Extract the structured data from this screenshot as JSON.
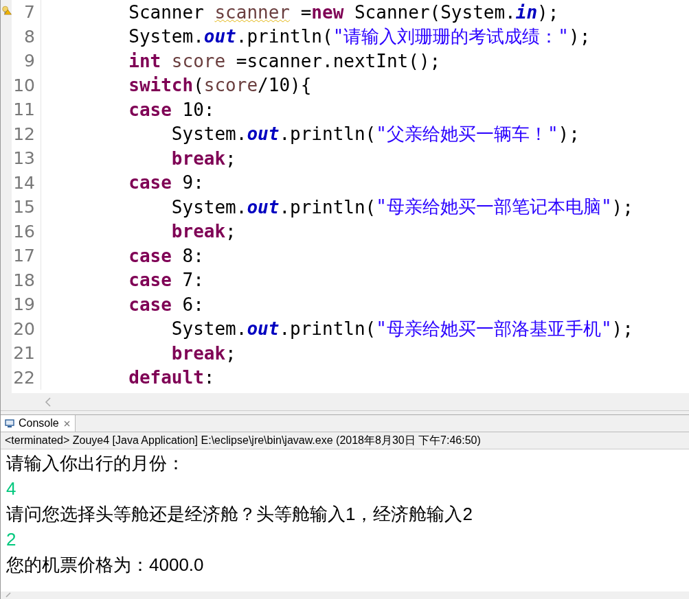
{
  "editor": {
    "lines": [
      {
        "number": "7",
        "marker": true,
        "tokens": [
          {
            "kind": "plain",
            "text": "        Scanner "
          },
          {
            "kind": "warn-var",
            "text": "scanner"
          },
          {
            "kind": "plain",
            "text": " ="
          },
          {
            "kind": "keyword",
            "text": "new"
          },
          {
            "kind": "plain",
            "text": " Scanner(System."
          },
          {
            "kind": "field",
            "text": "in"
          },
          {
            "kind": "plain",
            "text": ");"
          }
        ]
      },
      {
        "number": "8",
        "marker": false,
        "tokens": [
          {
            "kind": "plain",
            "text": "        System."
          },
          {
            "kind": "field",
            "text": "out"
          },
          {
            "kind": "plain",
            "text": ".println("
          },
          {
            "kind": "string",
            "text": "\"请输入刘珊珊的考试成绩：\""
          },
          {
            "kind": "plain",
            "text": ");"
          }
        ]
      },
      {
        "number": "9",
        "marker": false,
        "tokens": [
          {
            "kind": "keyword",
            "text": "        int "
          },
          {
            "kind": "var",
            "text": "score"
          },
          {
            "kind": "plain",
            "text": " =scanner.nextInt();"
          }
        ]
      },
      {
        "number": "10",
        "marker": false,
        "tokens": [
          {
            "kind": "keyword",
            "text": "        switch"
          },
          {
            "kind": "plain",
            "text": "("
          },
          {
            "kind": "var",
            "text": "score"
          },
          {
            "kind": "plain",
            "text": "/10){"
          }
        ]
      },
      {
        "number": "11",
        "marker": false,
        "tokens": [
          {
            "kind": "keyword",
            "text": "        case"
          },
          {
            "kind": "plain",
            "text": " 10:"
          }
        ]
      },
      {
        "number": "12",
        "marker": false,
        "tokens": [
          {
            "kind": "plain",
            "text": "            System."
          },
          {
            "kind": "field",
            "text": "out"
          },
          {
            "kind": "plain",
            "text": ".println("
          },
          {
            "kind": "string",
            "text": "\"父亲给她买一辆车！\""
          },
          {
            "kind": "plain",
            "text": ");"
          }
        ]
      },
      {
        "number": "13",
        "marker": false,
        "tokens": [
          {
            "kind": "keyword",
            "text": "            break"
          },
          {
            "kind": "plain",
            "text": ";"
          }
        ]
      },
      {
        "number": "14",
        "marker": false,
        "tokens": [
          {
            "kind": "keyword",
            "text": "        case"
          },
          {
            "kind": "plain",
            "text": " 9:"
          }
        ]
      },
      {
        "number": "15",
        "marker": false,
        "tokens": [
          {
            "kind": "plain",
            "text": "            System."
          },
          {
            "kind": "field",
            "text": "out"
          },
          {
            "kind": "plain",
            "text": ".println("
          },
          {
            "kind": "string",
            "text": "\"母亲给她买一部笔记本电脑\""
          },
          {
            "kind": "plain",
            "text": ");"
          }
        ]
      },
      {
        "number": "16",
        "marker": false,
        "tokens": [
          {
            "kind": "keyword",
            "text": "            break"
          },
          {
            "kind": "plain",
            "text": ";"
          }
        ]
      },
      {
        "number": "17",
        "marker": false,
        "tokens": [
          {
            "kind": "keyword",
            "text": "        case"
          },
          {
            "kind": "plain",
            "text": " 8:"
          }
        ]
      },
      {
        "number": "18",
        "marker": false,
        "tokens": [
          {
            "kind": "keyword",
            "text": "        case"
          },
          {
            "kind": "plain",
            "text": " 7:"
          }
        ]
      },
      {
        "number": "19",
        "marker": false,
        "tokens": [
          {
            "kind": "keyword",
            "text": "        case"
          },
          {
            "kind": "plain",
            "text": " 6:"
          }
        ]
      },
      {
        "number": "20",
        "marker": false,
        "tokens": [
          {
            "kind": "plain",
            "text": "            System."
          },
          {
            "kind": "field",
            "text": "out"
          },
          {
            "kind": "plain",
            "text": ".println("
          },
          {
            "kind": "string",
            "text": "\"母亲给她买一部洛基亚手机\""
          },
          {
            "kind": "plain",
            "text": ");"
          }
        ]
      },
      {
        "number": "21",
        "marker": false,
        "tokens": [
          {
            "kind": "keyword",
            "text": "            break"
          },
          {
            "kind": "plain",
            "text": ";"
          }
        ]
      },
      {
        "number": "22",
        "marker": false,
        "tokens": [
          {
            "kind": "keyword",
            "text": "        default"
          },
          {
            "kind": "plain",
            "text": ":"
          }
        ]
      }
    ]
  },
  "console": {
    "tab": {
      "label": "Console",
      "selected": true
    },
    "status": "<terminated> Zouye4 [Java Application] E:\\eclipse\\jre\\bin\\javaw.exe (2018年8月30日 下午7:46:50)",
    "lines": [
      {
        "kind": "output",
        "text": "请输入你出行的月份："
      },
      {
        "kind": "input",
        "text": "4"
      },
      {
        "kind": "output",
        "text": "请问您选择头等舱还是经济舱？头等舱输入1，经济舱输入2"
      },
      {
        "kind": "input",
        "text": "2"
      },
      {
        "kind": "output",
        "text": "您的机票价格为：4000.0"
      }
    ]
  }
}
